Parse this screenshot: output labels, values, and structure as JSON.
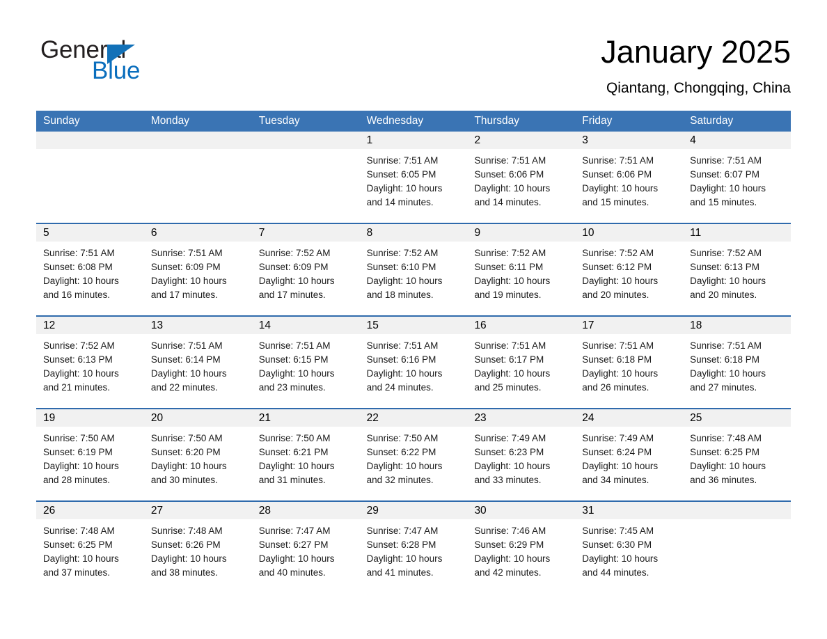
{
  "brand": {
    "name_part1": "General",
    "name_part2": "Blue",
    "triangle_color": "#1271b8",
    "blue_color": "#0a6ebd"
  },
  "header": {
    "title": "January 2025",
    "location": "Qiantang, Chongqing, China"
  },
  "theme": {
    "header_bar_color": "#3a74b4",
    "row_divider_color": "#2f6aac",
    "day_band_color": "#f1f1f1",
    "text_color": "#000000"
  },
  "weekdays": [
    "Sunday",
    "Monday",
    "Tuesday",
    "Wednesday",
    "Thursday",
    "Friday",
    "Saturday"
  ],
  "weeks": [
    {
      "days": [
        {
          "date": "",
          "sunrise": "",
          "sunset": "",
          "daylight": "",
          "empty": true
        },
        {
          "date": "",
          "sunrise": "",
          "sunset": "",
          "daylight": "",
          "empty": true
        },
        {
          "date": "",
          "sunrise": "",
          "sunset": "",
          "daylight": "",
          "empty": true
        },
        {
          "date": "1",
          "sunrise": "Sunrise: 7:51 AM",
          "sunset": "Sunset: 6:05 PM",
          "daylight": "Daylight: 10 hours and 14 minutes.",
          "empty": false
        },
        {
          "date": "2",
          "sunrise": "Sunrise: 7:51 AM",
          "sunset": "Sunset: 6:06 PM",
          "daylight": "Daylight: 10 hours and 14 minutes.",
          "empty": false
        },
        {
          "date": "3",
          "sunrise": "Sunrise: 7:51 AM",
          "sunset": "Sunset: 6:06 PM",
          "daylight": "Daylight: 10 hours and 15 minutes.",
          "empty": false
        },
        {
          "date": "4",
          "sunrise": "Sunrise: 7:51 AM",
          "sunset": "Sunset: 6:07 PM",
          "daylight": "Daylight: 10 hours and 15 minutes.",
          "empty": false
        }
      ]
    },
    {
      "days": [
        {
          "date": "5",
          "sunrise": "Sunrise: 7:51 AM",
          "sunset": "Sunset: 6:08 PM",
          "daylight": "Daylight: 10 hours and 16 minutes.",
          "empty": false
        },
        {
          "date": "6",
          "sunrise": "Sunrise: 7:51 AM",
          "sunset": "Sunset: 6:09 PM",
          "daylight": "Daylight: 10 hours and 17 minutes.",
          "empty": false
        },
        {
          "date": "7",
          "sunrise": "Sunrise: 7:52 AM",
          "sunset": "Sunset: 6:09 PM",
          "daylight": "Daylight: 10 hours and 17 minutes.",
          "empty": false
        },
        {
          "date": "8",
          "sunrise": "Sunrise: 7:52 AM",
          "sunset": "Sunset: 6:10 PM",
          "daylight": "Daylight: 10 hours and 18 minutes.",
          "empty": false
        },
        {
          "date": "9",
          "sunrise": "Sunrise: 7:52 AM",
          "sunset": "Sunset: 6:11 PM",
          "daylight": "Daylight: 10 hours and 19 minutes.",
          "empty": false
        },
        {
          "date": "10",
          "sunrise": "Sunrise: 7:52 AM",
          "sunset": "Sunset: 6:12 PM",
          "daylight": "Daylight: 10 hours and 20 minutes.",
          "empty": false
        },
        {
          "date": "11",
          "sunrise": "Sunrise: 7:52 AM",
          "sunset": "Sunset: 6:13 PM",
          "daylight": "Daylight: 10 hours and 20 minutes.",
          "empty": false
        }
      ]
    },
    {
      "days": [
        {
          "date": "12",
          "sunrise": "Sunrise: 7:52 AM",
          "sunset": "Sunset: 6:13 PM",
          "daylight": "Daylight: 10 hours and 21 minutes.",
          "empty": false
        },
        {
          "date": "13",
          "sunrise": "Sunrise: 7:51 AM",
          "sunset": "Sunset: 6:14 PM",
          "daylight": "Daylight: 10 hours and 22 minutes.",
          "empty": false
        },
        {
          "date": "14",
          "sunrise": "Sunrise: 7:51 AM",
          "sunset": "Sunset: 6:15 PM",
          "daylight": "Daylight: 10 hours and 23 minutes.",
          "empty": false
        },
        {
          "date": "15",
          "sunrise": "Sunrise: 7:51 AM",
          "sunset": "Sunset: 6:16 PM",
          "daylight": "Daylight: 10 hours and 24 minutes.",
          "empty": false
        },
        {
          "date": "16",
          "sunrise": "Sunrise: 7:51 AM",
          "sunset": "Sunset: 6:17 PM",
          "daylight": "Daylight: 10 hours and 25 minutes.",
          "empty": false
        },
        {
          "date": "17",
          "sunrise": "Sunrise: 7:51 AM",
          "sunset": "Sunset: 6:18 PM",
          "daylight": "Daylight: 10 hours and 26 minutes.",
          "empty": false
        },
        {
          "date": "18",
          "sunrise": "Sunrise: 7:51 AM",
          "sunset": "Sunset: 6:18 PM",
          "daylight": "Daylight: 10 hours and 27 minutes.",
          "empty": false
        }
      ]
    },
    {
      "days": [
        {
          "date": "19",
          "sunrise": "Sunrise: 7:50 AM",
          "sunset": "Sunset: 6:19 PM",
          "daylight": "Daylight: 10 hours and 28 minutes.",
          "empty": false
        },
        {
          "date": "20",
          "sunrise": "Sunrise: 7:50 AM",
          "sunset": "Sunset: 6:20 PM",
          "daylight": "Daylight: 10 hours and 30 minutes.",
          "empty": false
        },
        {
          "date": "21",
          "sunrise": "Sunrise: 7:50 AM",
          "sunset": "Sunset: 6:21 PM",
          "daylight": "Daylight: 10 hours and 31 minutes.",
          "empty": false
        },
        {
          "date": "22",
          "sunrise": "Sunrise: 7:50 AM",
          "sunset": "Sunset: 6:22 PM",
          "daylight": "Daylight: 10 hours and 32 minutes.",
          "empty": false
        },
        {
          "date": "23",
          "sunrise": "Sunrise: 7:49 AM",
          "sunset": "Sunset: 6:23 PM",
          "daylight": "Daylight: 10 hours and 33 minutes.",
          "empty": false
        },
        {
          "date": "24",
          "sunrise": "Sunrise: 7:49 AM",
          "sunset": "Sunset: 6:24 PM",
          "daylight": "Daylight: 10 hours and 34 minutes.",
          "empty": false
        },
        {
          "date": "25",
          "sunrise": "Sunrise: 7:48 AM",
          "sunset": "Sunset: 6:25 PM",
          "daylight": "Daylight: 10 hours and 36 minutes.",
          "empty": false
        }
      ]
    },
    {
      "days": [
        {
          "date": "26",
          "sunrise": "Sunrise: 7:48 AM",
          "sunset": "Sunset: 6:25 PM",
          "daylight": "Daylight: 10 hours and 37 minutes.",
          "empty": false
        },
        {
          "date": "27",
          "sunrise": "Sunrise: 7:48 AM",
          "sunset": "Sunset: 6:26 PM",
          "daylight": "Daylight: 10 hours and 38 minutes.",
          "empty": false
        },
        {
          "date": "28",
          "sunrise": "Sunrise: 7:47 AM",
          "sunset": "Sunset: 6:27 PM",
          "daylight": "Daylight: 10 hours and 40 minutes.",
          "empty": false
        },
        {
          "date": "29",
          "sunrise": "Sunrise: 7:47 AM",
          "sunset": "Sunset: 6:28 PM",
          "daylight": "Daylight: 10 hours and 41 minutes.",
          "empty": false
        },
        {
          "date": "30",
          "sunrise": "Sunrise: 7:46 AM",
          "sunset": "Sunset: 6:29 PM",
          "daylight": "Daylight: 10 hours and 42 minutes.",
          "empty": false
        },
        {
          "date": "31",
          "sunrise": "Sunrise: 7:45 AM",
          "sunset": "Sunset: 6:30 PM",
          "daylight": "Daylight: 10 hours and 44 minutes.",
          "empty": false
        },
        {
          "date": "",
          "sunrise": "",
          "sunset": "",
          "daylight": "",
          "empty": true
        }
      ]
    }
  ]
}
